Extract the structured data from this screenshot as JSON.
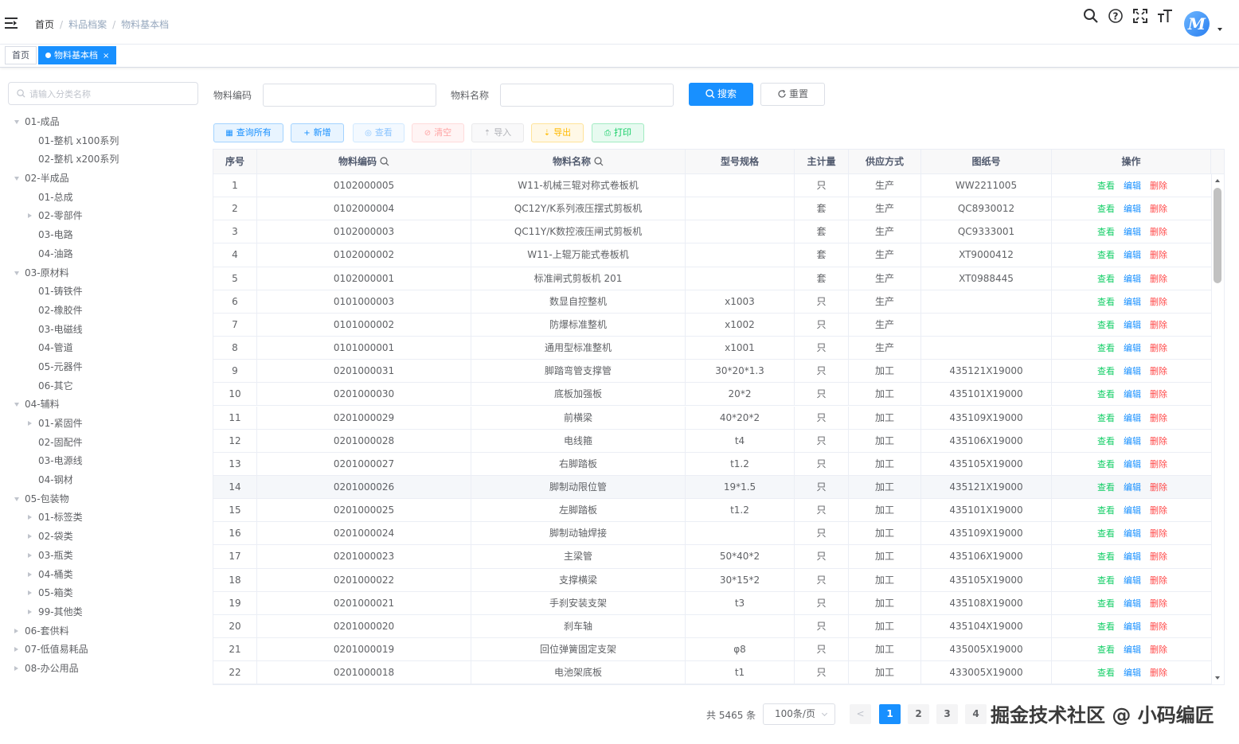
{
  "breadcrumb": [
    "首页",
    "料品档案",
    "物料基本档"
  ],
  "tags": [
    {
      "label": "首页",
      "active": false
    },
    {
      "label": "物料基本档",
      "active": true,
      "close": "×"
    }
  ],
  "tree": {
    "placeholder": "请输入分类名称",
    "nodes": [
      {
        "label": "01-成品",
        "level": 0,
        "arrow": "down"
      },
      {
        "label": "01-整机 x100系列",
        "level": 1,
        "arrow": "none"
      },
      {
        "label": "02-整机 x200系列",
        "level": 1,
        "arrow": "none"
      },
      {
        "label": "02-半成品",
        "level": 0,
        "arrow": "down"
      },
      {
        "label": "01-总成",
        "level": 1,
        "arrow": "none"
      },
      {
        "label": "02-零部件",
        "level": 1,
        "arrow": "right"
      },
      {
        "label": "03-电路",
        "level": 1,
        "arrow": "none"
      },
      {
        "label": "04-油路",
        "level": 1,
        "arrow": "none"
      },
      {
        "label": "03-原材料",
        "level": 0,
        "arrow": "down"
      },
      {
        "label": "01-铸铁件",
        "level": 1,
        "arrow": "none"
      },
      {
        "label": "02-橡胶件",
        "level": 1,
        "arrow": "none"
      },
      {
        "label": "03-电磁线",
        "level": 1,
        "arrow": "none"
      },
      {
        "label": "04-管道",
        "level": 1,
        "arrow": "none"
      },
      {
        "label": "05-元器件",
        "level": 1,
        "arrow": "none"
      },
      {
        "label": "06-其它",
        "level": 1,
        "arrow": "none"
      },
      {
        "label": "04-辅料",
        "level": 0,
        "arrow": "down"
      },
      {
        "label": "01-紧固件",
        "level": 1,
        "arrow": "right"
      },
      {
        "label": "02-固配件",
        "level": 1,
        "arrow": "none"
      },
      {
        "label": "03-电源线",
        "level": 1,
        "arrow": "none"
      },
      {
        "label": "04-钢材",
        "level": 1,
        "arrow": "none"
      },
      {
        "label": "05-包装物",
        "level": 0,
        "arrow": "down"
      },
      {
        "label": "01-标签类",
        "level": 1,
        "arrow": "right"
      },
      {
        "label": "02-袋类",
        "level": 1,
        "arrow": "right"
      },
      {
        "label": "03-瓶类",
        "level": 1,
        "arrow": "right"
      },
      {
        "label": "04-桶类",
        "level": 1,
        "arrow": "right"
      },
      {
        "label": "05-箱类",
        "level": 1,
        "arrow": "right"
      },
      {
        "label": "99-其他类",
        "level": 1,
        "arrow": "right"
      },
      {
        "label": "06-套供料",
        "level": 0,
        "arrow": "right"
      },
      {
        "label": "07-低值易耗品",
        "level": 0,
        "arrow": "right"
      },
      {
        "label": "08-办公用品",
        "level": 0,
        "arrow": "right"
      }
    ]
  },
  "search": {
    "code_label": "物料编码",
    "code_value": "",
    "name_label": "物料名称",
    "name_value": "",
    "search_button": "搜索",
    "reset_button": "重置"
  },
  "toolbar": [
    {
      "key": "query_all",
      "label": "查询所有",
      "icon": "grid-icon",
      "color": "#1890ff",
      "bg": "#e8f4ff",
      "border": "#a3d3ff"
    },
    {
      "key": "add",
      "label": "新增",
      "icon": "plus-icon",
      "color": "#1890ff",
      "bg": "#e8f4ff",
      "border": "#a3d3ff"
    },
    {
      "key": "view",
      "label": "查看",
      "icon": "eye-icon",
      "color": "#8cc5ff",
      "bg": "#f3f9ff",
      "border": "#d1e9ff"
    },
    {
      "key": "clear",
      "label": "清空",
      "icon": "clear-icon",
      "color": "#ffa4a4",
      "bg": "#fff4f4",
      "border": "#ffdbdb"
    },
    {
      "key": "import",
      "label": "导入",
      "icon": "upload-icon",
      "color": "#b1b3b8",
      "bg": "#f9f9fa",
      "border": "#e9e9eb"
    },
    {
      "key": "export",
      "label": "导出",
      "icon": "download-icon",
      "color": "#ffba00",
      "bg": "#fff8e6",
      "border": "#ffe399"
    },
    {
      "key": "print",
      "label": "打印",
      "icon": "printer-icon",
      "color": "#13ce66",
      "bg": "#e7faf0",
      "border": "#a1ebc2"
    }
  ],
  "table": {
    "columns": [
      "序号",
      "物料编码",
      "物料名称",
      "型号规格",
      "主计量",
      "供应方式",
      "图纸号",
      "操作"
    ],
    "ops": {
      "view": "查看",
      "edit": "编辑",
      "delete": "删除"
    },
    "rows": [
      [
        "1",
        "0102000005",
        "W11-机械三辊对称式卷板机",
        "",
        "只",
        "生产",
        "WW2211005"
      ],
      [
        "2",
        "0102000004",
        "QC12Y/K系列液压摆式剪板机",
        "",
        "套",
        "生产",
        "QC8930012"
      ],
      [
        "3",
        "0102000003",
        "QC11Y/K数控液压闸式剪板机",
        "",
        "套",
        "生产",
        "QC9333001"
      ],
      [
        "4",
        "0102000002",
        "W11-上辊万能式卷板机",
        "",
        "套",
        "生产",
        "XT9000412"
      ],
      [
        "5",
        "0102000001",
        "标准闸式剪板机 201",
        "",
        "套",
        "生产",
        "XT0988445"
      ],
      [
        "6",
        "0101000003",
        "数显自控整机",
        "x1003",
        "只",
        "生产",
        ""
      ],
      [
        "7",
        "0101000002",
        "防爆标准整机",
        "x1002",
        "只",
        "生产",
        ""
      ],
      [
        "8",
        "0101000001",
        "通用型标准整机",
        "x1001",
        "只",
        "生产",
        ""
      ],
      [
        "9",
        "0201000031",
        "脚踏弯管支撑管",
        "30*20*1.3",
        "只",
        "加工",
        "435121X19000"
      ],
      [
        "10",
        "0201000030",
        "底板加强板",
        "20*2",
        "只",
        "加工",
        "435101X19000"
      ],
      [
        "11",
        "0201000029",
        "前横梁",
        "40*20*2",
        "只",
        "加工",
        "435109X19000"
      ],
      [
        "12",
        "0201000028",
        "电线箍",
        "t4",
        "只",
        "加工",
        "435106X19000"
      ],
      [
        "13",
        "0201000027",
        "右脚踏板",
        "t1.2",
        "只",
        "加工",
        "435105X19000"
      ],
      [
        "14",
        "0201000026",
        "脚制动限位管",
        "19*1.5",
        "只",
        "加工",
        "435121X19000"
      ],
      [
        "15",
        "0201000025",
        "左脚踏板",
        "t1.2",
        "只",
        "加工",
        "435101X19000"
      ],
      [
        "16",
        "0201000024",
        "脚制动轴焊接",
        "",
        "只",
        "加工",
        "435109X19000"
      ],
      [
        "17",
        "0201000023",
        "主梁管",
        "50*40*2",
        "只",
        "加工",
        "435106X19000"
      ],
      [
        "18",
        "0201000022",
        "支撑横梁",
        "30*15*2",
        "只",
        "加工",
        "435105X19000"
      ],
      [
        "19",
        "0201000021",
        "手刹安装支架",
        "t3",
        "只",
        "加工",
        "435108X19000"
      ],
      [
        "20",
        "0201000020",
        "刹车轴",
        "",
        "只",
        "加工",
        "435104X19000"
      ],
      [
        "21",
        "0201000019",
        "回位弹簧固定支架",
        "φ8",
        "只",
        "加工",
        "435005X19000"
      ],
      [
        "22",
        "0201000018",
        "电池架底板",
        "t1",
        "只",
        "加工",
        "433005X19000"
      ]
    ]
  },
  "pagination": {
    "total_text": "共 5465 条",
    "page_size": "100条/页",
    "prev": "<",
    "pages": [
      "1",
      "2",
      "3",
      "4"
    ],
    "active_page": "1"
  },
  "watermark": "掘金技术社区 @ 小码编匠",
  "avatar_letter": "M",
  "colors": {
    "primary": "#1890ff",
    "success": "#13ce66",
    "danger": "#ff4949"
  }
}
